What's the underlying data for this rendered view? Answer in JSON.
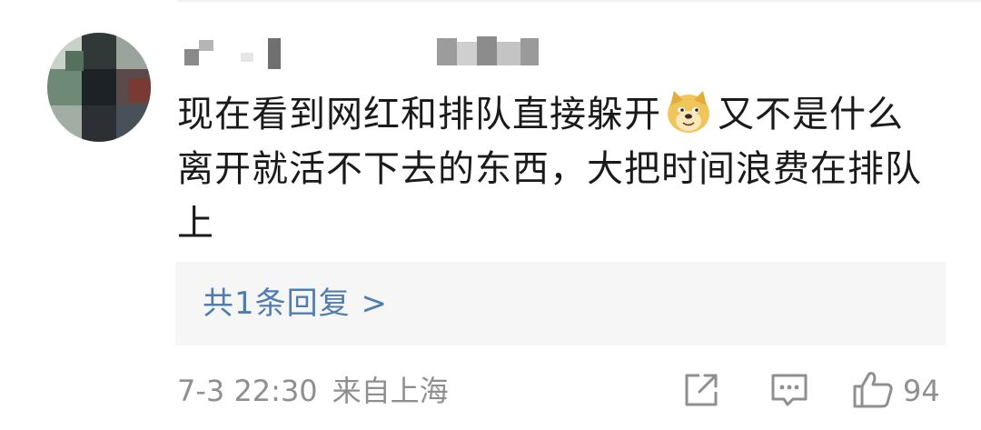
{
  "comment": {
    "text_line_1a": "现在看到网红和排队直接躲开",
    "text_line_1b": "又不是什么",
    "text_line_2": "离开就活不下去的东西，大把时间浪费在排队",
    "text_line_3": "上",
    "emoji": "doge-icon"
  },
  "replies": {
    "label": "共1条回复 >"
  },
  "meta": {
    "time": "7-3 22:30",
    "source": "来自上海"
  },
  "actions": {
    "share_icon": "share-icon",
    "comment_icon": "comment-icon",
    "like_icon": "thumbs-up-icon",
    "like_count": "94"
  },
  "colors": {
    "link": "#507daf",
    "meta_text": "#8f8f8f",
    "reply_bg": "#f6f6f6"
  }
}
